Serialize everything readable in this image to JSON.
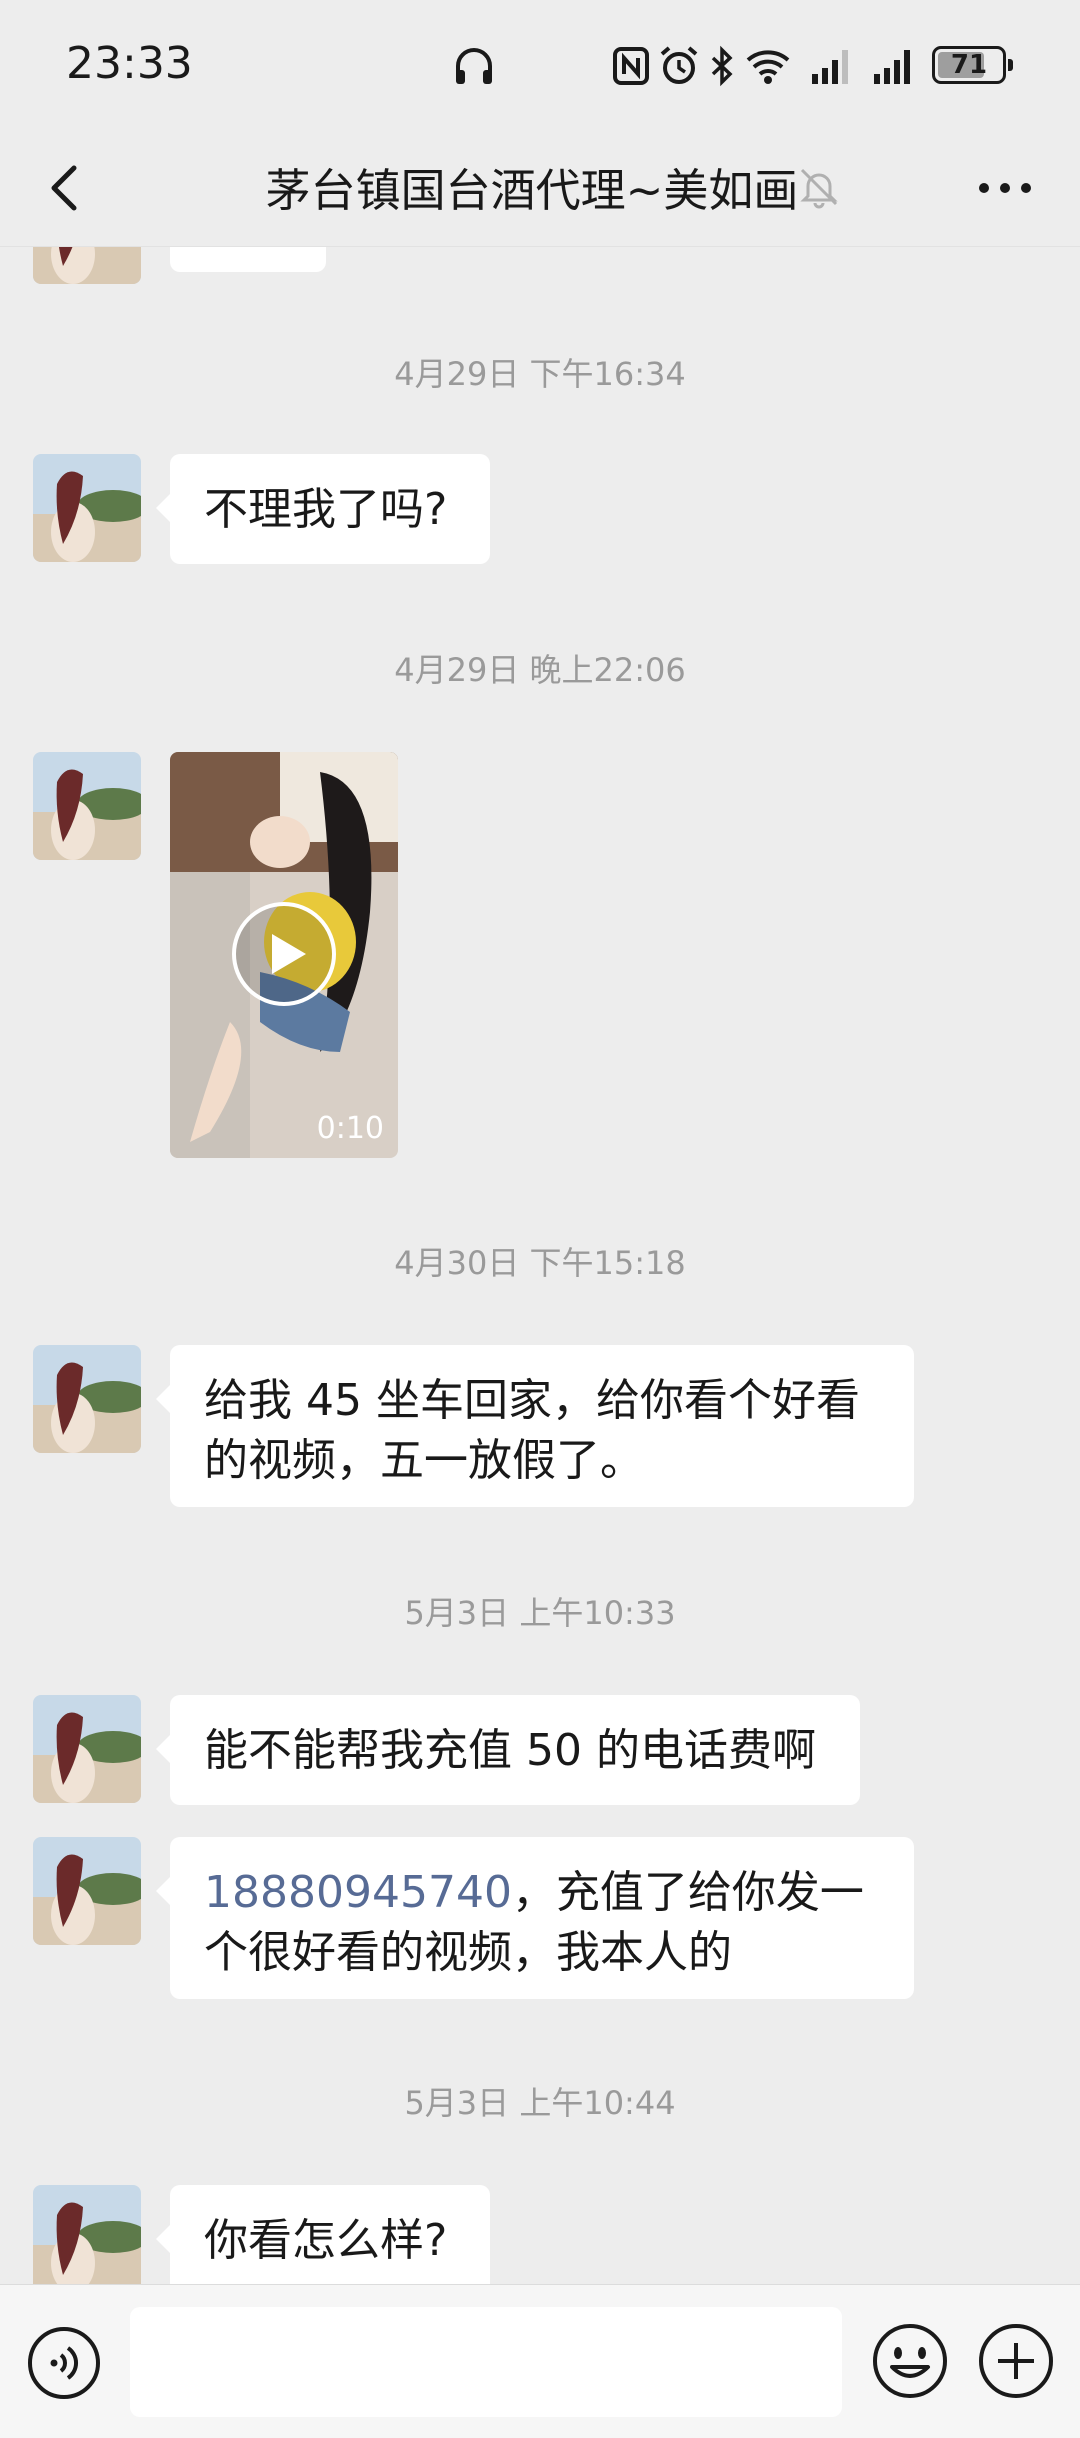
{
  "status_bar": {
    "time": "23:33",
    "battery": "71",
    "icons": [
      "headphones-icon",
      "nfc-icon",
      "alarm-icon",
      "bluetooth-icon",
      "wifi-icon",
      "signal-icon",
      "signal-icon",
      "battery-icon"
    ]
  },
  "header": {
    "title": "茅台镇国台酒代理~美如画",
    "icons": [
      "back-arrow-icon",
      "mute-bell-icon",
      "more-dots-icon"
    ]
  },
  "messages": [
    {
      "type": "timestamp",
      "text": "4月29日 下午16:34"
    },
    {
      "type": "text",
      "text": "不理我了吗?"
    },
    {
      "type": "timestamp",
      "text": "4月29日 晚上22:06"
    },
    {
      "type": "video",
      "duration": "0:10"
    },
    {
      "type": "timestamp",
      "text": "4月30日 下午15:18"
    },
    {
      "type": "text",
      "lines": [
        "给我 45 坐车回家，给你看个好看",
        "的视频，五一放假了。"
      ]
    },
    {
      "type": "timestamp",
      "text": "5月3日 上午10:33"
    },
    {
      "type": "text",
      "text": "能不能帮我充值 50 的电话费啊"
    },
    {
      "type": "text",
      "link": "18880945740",
      "line1_rest": "，充值了给你发一",
      "line2": "个很好看的视频，我本人的"
    },
    {
      "type": "timestamp",
      "text": "5月3日 上午10:44"
    },
    {
      "type": "text",
      "text": "你看怎么样?"
    }
  ],
  "input_bar": {
    "placeholder": "",
    "icons": [
      "voice-icon",
      "emoji-icon",
      "plus-icon"
    ]
  },
  "colors": {
    "background": "#ededed",
    "bubble": "#ffffff",
    "link": "#576b95",
    "timestamp": "#9a9a9a"
  }
}
